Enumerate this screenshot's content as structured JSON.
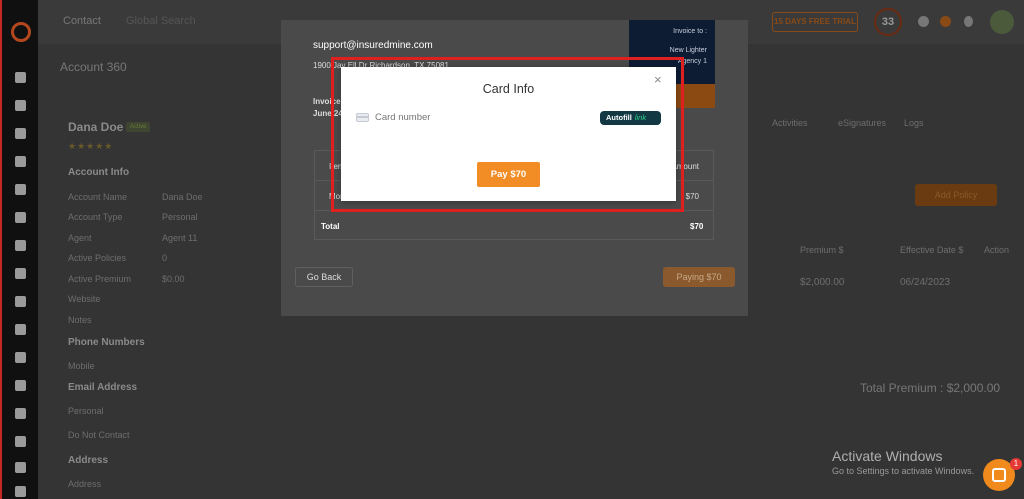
{
  "topbar": {
    "contact_label": "Contact",
    "search_placeholder": "Global Search",
    "trial_label": "15 DAYS FREE TRIAL",
    "notification_count": "33"
  },
  "page": {
    "title": "Account 360"
  },
  "account": {
    "name": "Dana Doe",
    "status_badge": "Active",
    "section_info": "Account Info",
    "fields": [
      {
        "label": "Account Name",
        "value": "Dana Doe"
      },
      {
        "label": "Account Type",
        "value": "Personal"
      },
      {
        "label": "Agent",
        "value": "Agent 11"
      },
      {
        "label": "Active Policies",
        "value": "0"
      },
      {
        "label": "Active Premium",
        "value": "$0.00"
      },
      {
        "label": "Website",
        "value": ""
      },
      {
        "label": "Notes",
        "value": ""
      }
    ],
    "phone_heading": "Phone Numbers",
    "phone_label": "Mobile",
    "email_heading": "Email Address",
    "email_label": "Personal",
    "do_not_contact": "Do Not Contact",
    "address_heading": "Address",
    "address_label": "Address"
  },
  "tabs": [
    "Activities",
    "eSignatures",
    "Logs"
  ],
  "policies": {
    "add_button": "Add Policy",
    "columns": [
      "Premium $",
      "Effective Date $",
      "Action"
    ],
    "row": {
      "premium": "$2,000.00",
      "effective_date": "06/24/2023"
    },
    "total_label": "Total Premium : $2,000.00"
  },
  "invoice": {
    "email": "support@insuredmine.com",
    "address": "1900 Jay Ell Dr Richardson, TX 75081",
    "invoice_label": "Invoice",
    "invoice_date": "June 24",
    "invoice_to": "Invoice to :",
    "to_line1": "New Lighter",
    "to_line2": "Agency 1",
    "col_item": "Item",
    "col_amount": "Amount",
    "row_item": "Monthly",
    "row_amount": "$70",
    "total_label": "Total",
    "total_value": "$70",
    "go_back": "Go Back",
    "paying": "Paying $70"
  },
  "card_modal": {
    "title": "Card Info",
    "close": "×",
    "card_placeholder": "Card number",
    "autofill_label": "Autofill",
    "link_label": "link",
    "pay_button": "Pay $70"
  },
  "windows": {
    "activate_title": "Activate Windows",
    "activate_sub": "Go to Settings to activate Windows."
  },
  "chat": {
    "badge": "1"
  },
  "colors": {
    "accent_orange": "#f28c24",
    "highlight_red": "#e0201e",
    "autofill_bg": "#123844",
    "link_green": "#2fd58a"
  }
}
